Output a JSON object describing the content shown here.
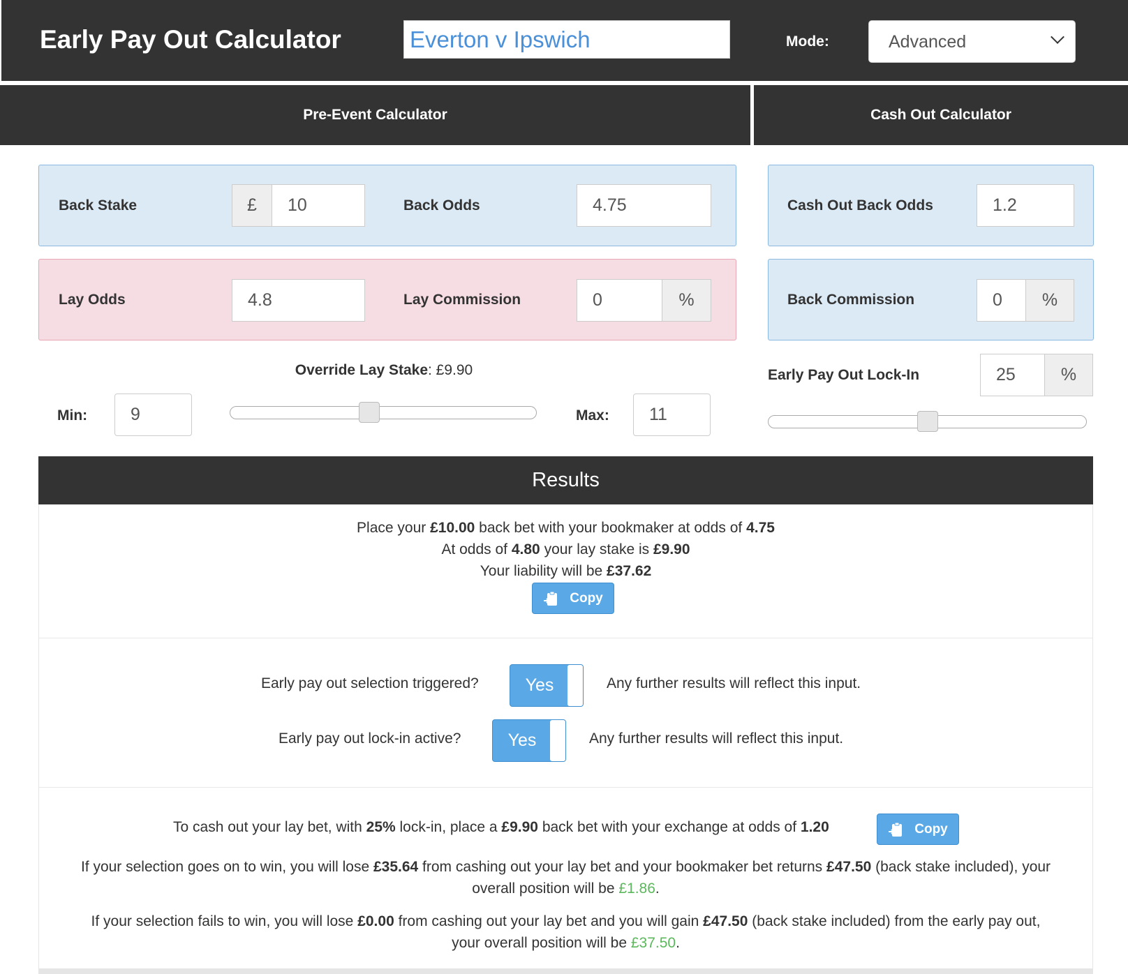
{
  "header": {
    "title": "Early Pay Out Calculator",
    "event_value": "Everton v Ipswich",
    "mode_label": "Mode:",
    "mode_value": "Advanced"
  },
  "tabs": {
    "pre_event": "Pre-Event Calculator",
    "cash_out": "Cash Out Calculator"
  },
  "pre_event": {
    "back_stake_label": "Back Stake",
    "currency_symbol": "£",
    "back_stake_value": "10",
    "back_odds_label": "Back Odds",
    "back_odds_value": "4.75",
    "lay_odds_label": "Lay Odds",
    "lay_odds_value": "4.8",
    "lay_commission_label": "Lay Commission",
    "lay_commission_value": "0",
    "percent": "%",
    "override_label": "Override Lay Stake",
    "override_value": ": £9.90",
    "min_label": "Min:",
    "min_value": "9",
    "max_label": "Max:",
    "max_value": "11",
    "override_slider_level": 0.45
  },
  "cash_out": {
    "back_odds_label": "Cash Out Back Odds",
    "back_odds_value": "1.2",
    "back_commission_label": "Back Commission",
    "back_commission_value": "0",
    "percent": "%",
    "lockin_label": "Early Pay Out Lock-In",
    "lockin_value": "25",
    "lockin_slider_level": 0.5
  },
  "results": {
    "title": "Results",
    "line1": {
      "a": "Place your ",
      "b": "£10.00",
      "c": " back bet with your bookmaker at odds of ",
      "d": "4.75"
    },
    "line2": {
      "a": "At odds of ",
      "b": "4.80",
      "c": " your lay stake is ",
      "d": "£9.90"
    },
    "line3": {
      "a": "Your liability will be ",
      "b": "£37.62"
    },
    "copy_label": "Copy",
    "q1": "Early pay out selection triggered?",
    "q1_toggle": "Yes",
    "q1_note": "Any further results will reflect this input.",
    "q2": "Early pay out lock-in active?",
    "q2_toggle": "Yes",
    "q2_note": "Any further results will reflect this input.",
    "cash_line": {
      "a": "To cash out your lay bet, with ",
      "b": "25%",
      "c": " lock-in, place a ",
      "d": "£9.90",
      "e": " back bet with your exchange at odds of ",
      "f": "1.20"
    },
    "win_line": {
      "a": "If your selection goes on to win, you will lose ",
      "b": "£35.64",
      "c": " from cashing out your lay bet and your bookmaker bet returns ",
      "d": "£47.50",
      "e": " (back stake included), your",
      "f": "overall position will be ",
      "g": "£1.86",
      "h": "."
    },
    "lose_line": {
      "a": "If your selection fails to win, you will lose ",
      "b": "£0.00",
      "c": " from cashing out your lay bet and you will gain ",
      "d": "£47.50",
      "e": " (back stake included) from the early pay out,",
      "f": "your overall position will be ",
      "g": "£37.50",
      "h": "."
    }
  },
  "colors": {
    "header_bg": "#333333",
    "panel_blue": "#dceaf6",
    "panel_pink": "#f5dde3",
    "accent_blue": "#5aa9e6",
    "positive_green": "#5cb85c"
  }
}
